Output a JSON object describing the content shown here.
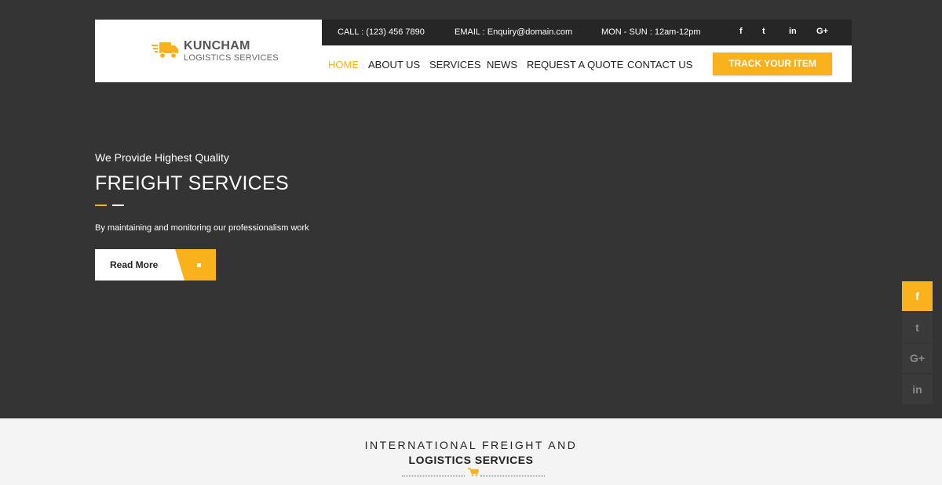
{
  "brand": {
    "name": "KUNCHAM",
    "tagline": "LOGISTICS SERVICES",
    "icon": "truck-icon"
  },
  "topbar": {
    "call": "CALL : (123) 456 7890",
    "email": "EMAIL : Enquiry@domain.com",
    "hours": "MON - SUN : 12am-12pm",
    "social": [
      {
        "icon": "facebook-icon",
        "glyph": "f"
      },
      {
        "icon": "twitter-icon",
        "glyph": "t"
      },
      {
        "icon": "linkedin-icon",
        "glyph": "in"
      },
      {
        "icon": "google-plus-icon",
        "glyph": "G+"
      }
    ]
  },
  "nav": {
    "items": [
      {
        "label": "HOME",
        "active": true
      },
      {
        "label": "ABOUT US",
        "active": false
      },
      {
        "label": "SERVICES",
        "active": false
      },
      {
        "label": "NEWS",
        "active": false
      },
      {
        "label": "REQUEST A QUOTE",
        "active": false
      },
      {
        "label": "CONTACT US",
        "active": false
      }
    ],
    "cta": "TRACK YOUR ITEM"
  },
  "hero": {
    "tagline": "We Provide Highest Quality",
    "title": "FREIGHT SERVICES",
    "text": "By maintaining and monitoring our professionalism work",
    "button": "Read More"
  },
  "side_social": [
    {
      "icon": "facebook-icon",
      "glyph": "f",
      "active": true
    },
    {
      "icon": "twitter-icon",
      "glyph": "t",
      "active": false
    },
    {
      "icon": "google-plus-icon",
      "glyph": "G+",
      "active": false
    },
    {
      "icon": "linkedin-icon",
      "glyph": "in",
      "active": false
    }
  ],
  "section": {
    "line1": "INTERNATIONAL FREIGHT AND",
    "line2": "LOGISTICS SERVICES",
    "icon": "cart-icon"
  },
  "colors": {
    "accent": "#f9b11c",
    "hero_bg": "#343434",
    "topbar_bg": "#262626",
    "section_bg": "#f4f4f4"
  }
}
